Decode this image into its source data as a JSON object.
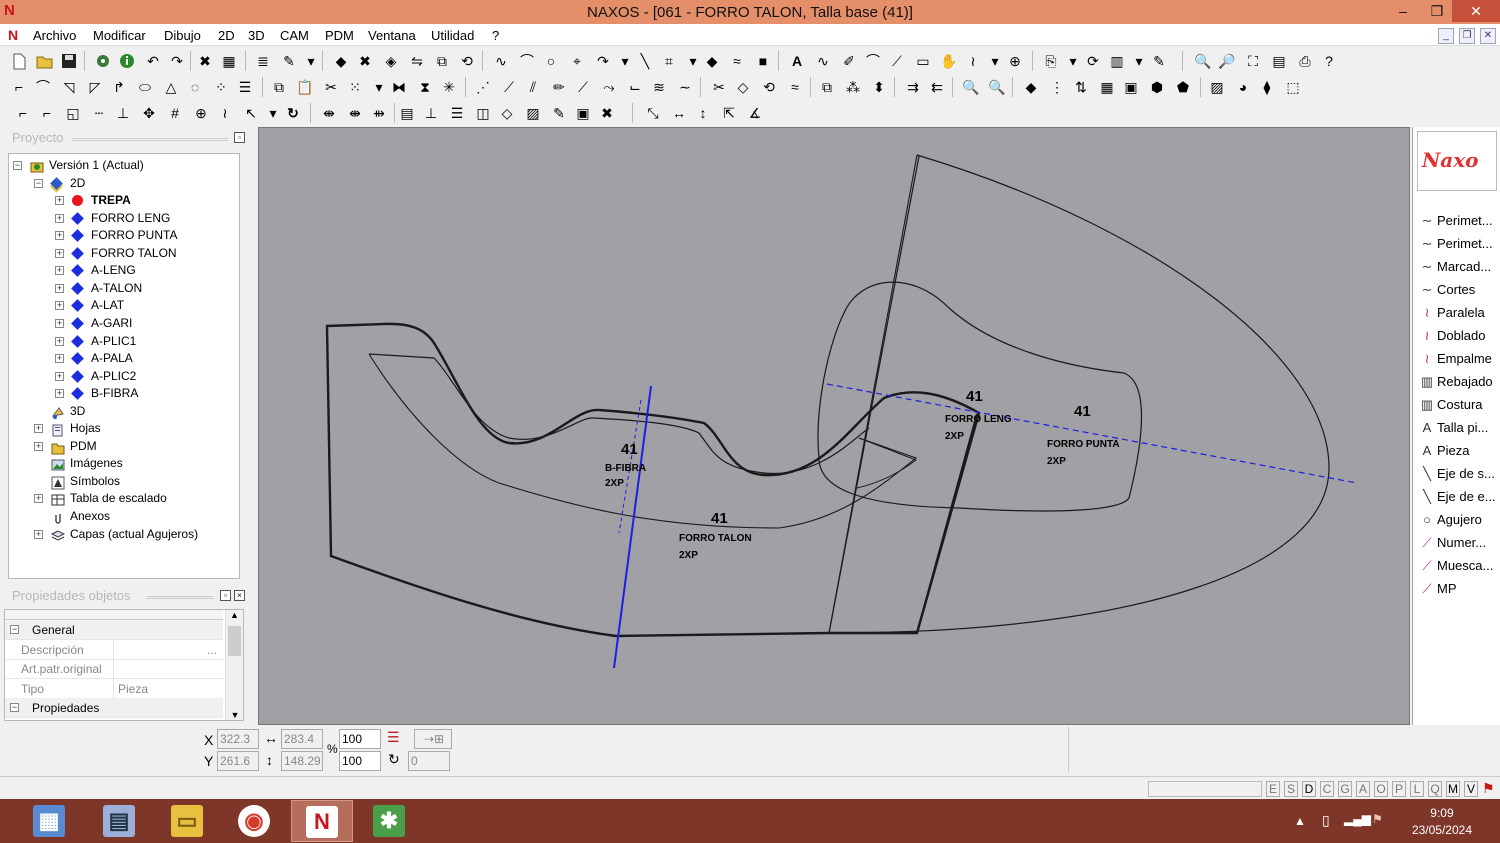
{
  "window": {
    "title": "NAXOS - [061 - FORRO TALON, Talla base (41)]",
    "app_logo": "N",
    "controls": [
      "–",
      "❐",
      "✕"
    ]
  },
  "menu": {
    "logo": "N",
    "items": [
      "Archivo",
      "Modificar",
      "Dibujo",
      "2D",
      "3D",
      "CAM",
      "PDM",
      "Ventana",
      "Utilidad",
      "?"
    ],
    "mdi_controls": [
      "_",
      "❐",
      "✕"
    ]
  },
  "project_panel": {
    "title": "Proyecto",
    "tree": [
      {
        "label": "Versión 1 (Actual)",
        "level": 0,
        "toggle": "−",
        "icon": "version"
      },
      {
        "label": "2D",
        "level": 1,
        "toggle": "−",
        "icon": "2d"
      },
      {
        "label": "TREPA",
        "level": 2,
        "toggle": "+",
        "icon": "red",
        "bold": true
      },
      {
        "label": "FORRO LENG",
        "level": 2,
        "toggle": "+",
        "icon": "blue"
      },
      {
        "label": "FORRO PUNTA",
        "level": 2,
        "toggle": "+",
        "icon": "blue"
      },
      {
        "label": "FORRO TALON",
        "level": 2,
        "toggle": "+",
        "icon": "blue"
      },
      {
        "label": "A-LENG",
        "level": 2,
        "toggle": "+",
        "icon": "blue"
      },
      {
        "label": "A-TALON",
        "level": 2,
        "toggle": "+",
        "icon": "blue"
      },
      {
        "label": "A-LAT",
        "level": 2,
        "toggle": "+",
        "icon": "blue"
      },
      {
        "label": "A-GARI",
        "level": 2,
        "toggle": "+",
        "icon": "blue"
      },
      {
        "label": "A-PLIC1",
        "level": 2,
        "toggle": "+",
        "icon": "blue"
      },
      {
        "label": "A-PALA",
        "level": 2,
        "toggle": "+",
        "icon": "blue"
      },
      {
        "label": "A-PLIC2",
        "level": 2,
        "toggle": "+",
        "icon": "blue"
      },
      {
        "label": "B-FIBRA",
        "level": 2,
        "toggle": "+",
        "icon": "blue"
      },
      {
        "label": "3D",
        "level": 1,
        "toggle": "",
        "icon": "3d"
      },
      {
        "label": "Hojas",
        "level": 1,
        "toggle": "+",
        "icon": "sheets"
      },
      {
        "label": "PDM",
        "level": 1,
        "toggle": "+",
        "icon": "folder"
      },
      {
        "label": "Imágenes",
        "level": 1,
        "toggle": "",
        "icon": "image"
      },
      {
        "label": "Símbolos",
        "level": 1,
        "toggle": "",
        "icon": "symbol"
      },
      {
        "label": "Tabla de escalado",
        "level": 1,
        "toggle": "+",
        "icon": "table"
      },
      {
        "label": "Anexos",
        "level": 1,
        "toggle": "",
        "icon": "clip"
      },
      {
        "label": "Capas (actual Agujeros)",
        "level": 1,
        "toggle": "+",
        "icon": "layers"
      }
    ]
  },
  "properties_panel": {
    "title": "Propiedades objetos",
    "rows": [
      {
        "name": "General",
        "value": "",
        "group": true,
        "toggle": "−"
      },
      {
        "name": "Descripción",
        "value": "...",
        "group": false
      },
      {
        "name": "Art.patr.original",
        "value": "",
        "group": false
      },
      {
        "name": "Tipo",
        "value": "Pieza",
        "group": false
      },
      {
        "name": "Propiedades",
        "value": "",
        "group": true,
        "toggle": "−"
      }
    ]
  },
  "canvas": {
    "pieces": [
      {
        "size": "41",
        "name": "B-FIBRA",
        "qty": "2XP"
      },
      {
        "size": "41",
        "name": "FORRO TALON",
        "qty": "2XP"
      },
      {
        "size": "41",
        "name": "FORRO LENG",
        "qty": "2XP"
      },
      {
        "size": "41",
        "name": "FORRO PUNTA",
        "qty": "2XP"
      }
    ],
    "colors": {
      "background": "#a0a0a5",
      "outline": "#1a1a1a",
      "axis": "#1e1ee6"
    }
  },
  "right_panel": {
    "brand": "Naxo",
    "tools": [
      {
        "label": "Perimet...",
        "icon": "curve-icon"
      },
      {
        "label": "Perimet...",
        "icon": "curve-icon"
      },
      {
        "label": "Marcad...",
        "icon": "curve-icon"
      },
      {
        "label": "Cortes",
        "icon": "curve-icon"
      },
      {
        "label": "Paralela",
        "icon": "wave-icon"
      },
      {
        "label": "Doblado",
        "icon": "wave-icon"
      },
      {
        "label": "Empalme",
        "icon": "wave-icon"
      },
      {
        "label": "Rebajado",
        "icon": "bars-icon"
      },
      {
        "label": "Costura",
        "icon": "bars-icon"
      },
      {
        "label": "Talla pi...",
        "icon": "text-icon"
      },
      {
        "label": "Pieza",
        "icon": "text-icon"
      },
      {
        "label": "Eje de s...",
        "icon": "axis-icon"
      },
      {
        "label": "Eje de e...",
        "icon": "axis-icon"
      },
      {
        "label": "Agujero",
        "icon": "circle-icon"
      },
      {
        "label": "Numer...",
        "icon": "pen-icon"
      },
      {
        "label": "Muesca...",
        "icon": "pen-icon"
      },
      {
        "label": "MP",
        "icon": "pen-icon"
      }
    ]
  },
  "coords": {
    "x_label": "X",
    "y_label": "Y",
    "x": "322.3",
    "y": "261.6",
    "width": "283.4",
    "height": "148.29",
    "percent_label": "%",
    "scale_x": "100",
    "scale_y": "100",
    "rotation": "0"
  },
  "status": {
    "letters": [
      "E",
      "S",
      "D",
      "C",
      "G",
      "A",
      "O",
      "P",
      "L",
      "Q",
      "M",
      "V"
    ]
  },
  "taskbar": {
    "time": "9:09",
    "date": "23/05/2024",
    "apps": [
      "calculator",
      "explorer-window",
      "file-explorer",
      "chrome",
      "naxos",
      "leaf-app"
    ]
  }
}
